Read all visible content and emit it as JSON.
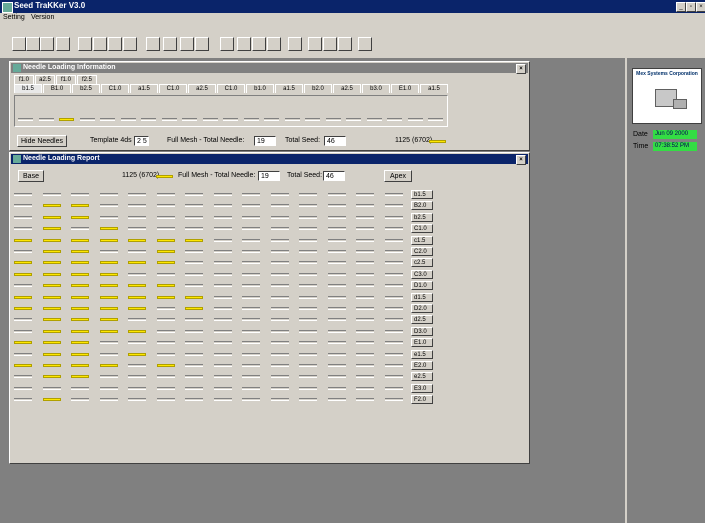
{
  "app": {
    "title": "Seed TraKKer V3.0",
    "menu": [
      "Setting",
      "Version"
    ]
  },
  "toolbar_icons": [
    "new-icon",
    "open-icon",
    "save-icon",
    "print-icon",
    "window-icon",
    "window2-icon",
    "window3-icon",
    "clock-icon",
    "graph-icon",
    "stop-icon",
    "grid-icon",
    "ct-icon",
    "report-icon",
    "u-icon",
    "x-icon",
    "forward-icon",
    "template-icon",
    "panel-icon",
    "square-icon",
    "eraser-icon",
    "ruler-icon"
  ],
  "info_win": {
    "title": "Needle Loading Information",
    "tabs_row1": [
      "f1.0",
      "a2.5",
      "f1.0",
      "f2.5"
    ],
    "tabs_row2": [
      "b1.5",
      "B1.0",
      "b2.5",
      "C1.0",
      "a1.5",
      "C1.0",
      "a2.5",
      "C1.0",
      "b1.0",
      "a1.5",
      "b2.0",
      "a2.5",
      "b3.0",
      "E1.0",
      "a1.5"
    ],
    "bar_pattern": [
      0,
      0,
      1,
      0,
      0,
      0,
      0,
      0,
      0,
      0,
      0,
      0,
      0,
      0,
      0,
      0,
      0,
      0,
      0,
      0,
      0
    ],
    "hide_button": "Hide Needles",
    "template_label": "Template 4ds",
    "template_value": "2 5",
    "fullmesh_label": "Full Mesh - Total Needle:",
    "total_needle": "19",
    "total_seed_label": "Total Seed:",
    "total_seed": "46",
    "legend": "1125 (6702)"
  },
  "report_win": {
    "title": "Needle Loading Report",
    "base_button": "Base",
    "apex_button": "Apex",
    "legend": "1125 (6702)",
    "fullmesh_label": "Full Mesh - Total Needle:",
    "total_needle": "19",
    "total_seed_label": "Total Seed:",
    "total_seed": "46",
    "rows": [
      {
        "label": "b1.5",
        "on": [
          0,
          0,
          0,
          0,
          0,
          0,
          0,
          0,
          0,
          0,
          0,
          0,
          0,
          0
        ]
      },
      {
        "label": "B2.0",
        "on": [
          0,
          1,
          1,
          0,
          0,
          0,
          0,
          0,
          0,
          0,
          0,
          0,
          0,
          0
        ]
      },
      {
        "label": "b2.5",
        "on": [
          0,
          1,
          1,
          0,
          0,
          0,
          0,
          0,
          0,
          0,
          0,
          0,
          0,
          0
        ]
      },
      {
        "label": "C1.0",
        "on": [
          0,
          1,
          0,
          1,
          0,
          0,
          0,
          0,
          0,
          0,
          0,
          0,
          0,
          0
        ]
      },
      {
        "label": "c1.5",
        "on": [
          1,
          1,
          1,
          1,
          1,
          1,
          1,
          0,
          0,
          0,
          0,
          0,
          0,
          0
        ]
      },
      {
        "label": "C2.0",
        "on": [
          0,
          1,
          1,
          0,
          0,
          1,
          0,
          0,
          0,
          0,
          0,
          0,
          0,
          0
        ]
      },
      {
        "label": "c2.5",
        "on": [
          1,
          1,
          1,
          1,
          1,
          1,
          0,
          0,
          0,
          0,
          0,
          0,
          0,
          0
        ]
      },
      {
        "label": "C3.0",
        "on": [
          1,
          1,
          1,
          1,
          0,
          0,
          0,
          0,
          0,
          0,
          0,
          0,
          0,
          0
        ]
      },
      {
        "label": "D1.0",
        "on": [
          0,
          1,
          1,
          1,
          1,
          1,
          0,
          0,
          0,
          0,
          0,
          0,
          0,
          0
        ]
      },
      {
        "label": "d1.5",
        "on": [
          1,
          1,
          1,
          1,
          1,
          1,
          1,
          0,
          0,
          0,
          0,
          0,
          0,
          0
        ]
      },
      {
        "label": "D2.0",
        "on": [
          1,
          1,
          1,
          1,
          1,
          0,
          1,
          0,
          0,
          0,
          0,
          0,
          0,
          0
        ]
      },
      {
        "label": "d2.5",
        "on": [
          0,
          1,
          1,
          1,
          0,
          0,
          0,
          0,
          0,
          0,
          0,
          0,
          0,
          0
        ]
      },
      {
        "label": "D3.0",
        "on": [
          0,
          1,
          1,
          1,
          1,
          0,
          0,
          0,
          0,
          0,
          0,
          0,
          0,
          0
        ]
      },
      {
        "label": "E1.0",
        "on": [
          1,
          1,
          1,
          0,
          0,
          0,
          0,
          0,
          0,
          0,
          0,
          0,
          0,
          0
        ]
      },
      {
        "label": "e1.5",
        "on": [
          0,
          1,
          1,
          0,
          1,
          0,
          0,
          0,
          0,
          0,
          0,
          0,
          0,
          0
        ]
      },
      {
        "label": "E2.0",
        "on": [
          1,
          1,
          1,
          1,
          0,
          1,
          0,
          0,
          0,
          0,
          0,
          0,
          0,
          0
        ]
      },
      {
        "label": "e2.5",
        "on": [
          0,
          1,
          1,
          0,
          0,
          0,
          0,
          0,
          0,
          0,
          0,
          0,
          0,
          0
        ]
      },
      {
        "label": "E3.0",
        "on": [
          0,
          0,
          0,
          0,
          0,
          0,
          0,
          0,
          0,
          0,
          0,
          0,
          0,
          0
        ]
      },
      {
        "label": "F2.0",
        "on": [
          0,
          1,
          0,
          0,
          0,
          0,
          0,
          0,
          0,
          0,
          0,
          0,
          0,
          0
        ]
      }
    ]
  },
  "side": {
    "company": "Mex Systems Corporation",
    "date_label": "Date",
    "date_value": "Jun 09 2000",
    "time_label": "Time",
    "time_value": "07:38:52 PM"
  },
  "colors": {
    "title_active": "#0a246a",
    "needle_on": "#ffe800",
    "date_bg": "#33dd44"
  }
}
